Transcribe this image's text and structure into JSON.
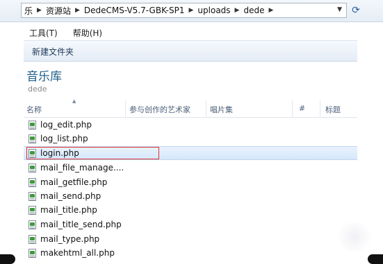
{
  "address_bar": {
    "crumbs": [
      "乐",
      "资源站",
      "DedeCMS-V5.7-GBK-SP1",
      "uploads",
      "dede"
    ]
  },
  "menu": {
    "items": [
      "工具(T)",
      "帮助(H)"
    ]
  },
  "toolbar": {
    "new_folder": "新建文件夹"
  },
  "library": {
    "title": "音乐库",
    "subtitle": "dede"
  },
  "columns": [
    "名称",
    "参与创作的艺术家",
    "唱片集",
    "#",
    "标题"
  ],
  "files": [
    "log_edit.php",
    "log_list.php",
    "login.php",
    "mail_file_manage....",
    "mail_getfile.php",
    "mail_send.php",
    "mail_title.php",
    "mail_title_send.php",
    "mail_type.php",
    "makehtml_all.php"
  ],
  "selected_file": "login.php",
  "colors": {
    "accent": "#1e5d8a",
    "selection": "#d5e7fb",
    "highlight_border": "#d33333"
  },
  "icons": {
    "file": "php-file-icon",
    "refresh": "refresh-icon",
    "dropdown": "chevron-down-icon"
  }
}
